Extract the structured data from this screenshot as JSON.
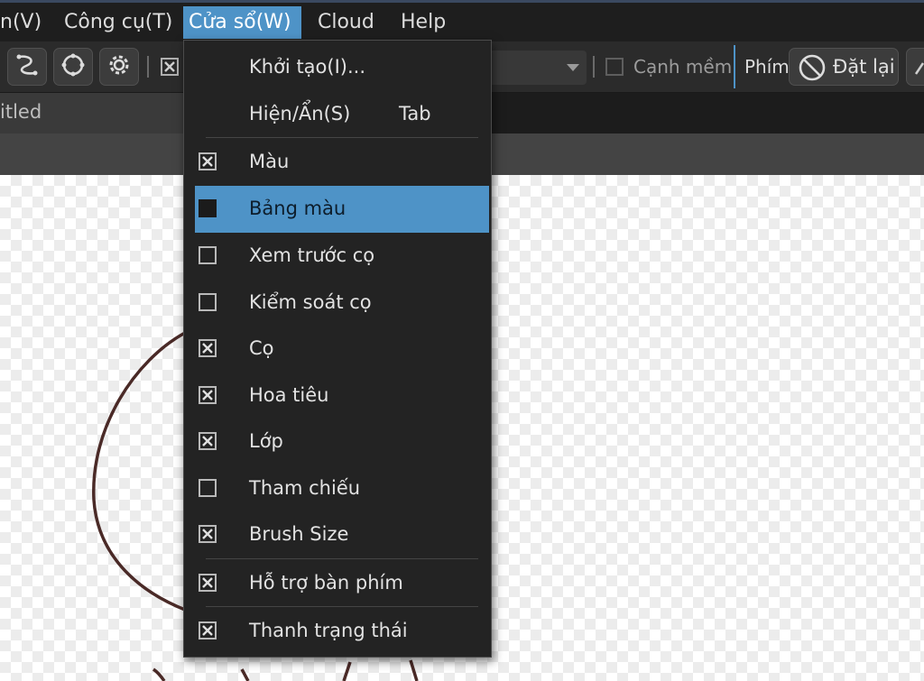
{
  "menubar": {
    "items": [
      "n(V)",
      "Công cụ(T)",
      "Cửa sổ(W)",
      "Cloud",
      "Help"
    ]
  },
  "toolbar": {
    "soft_edge_label": "Cạnh mềm",
    "key_label": "Phím",
    "reset_label": "Đặt lại"
  },
  "tab": {
    "title": "itled"
  },
  "window_menu": {
    "items": [
      {
        "label": "Khởi tạo(I)...",
        "check": "none"
      },
      {
        "label": "Hiện/Ẩn(S)",
        "shortcut": "Tab",
        "check": "none"
      },
      {
        "label": "Màu",
        "check": "checked"
      },
      {
        "label": "Bảng màu",
        "check": "filled",
        "highlighted": true
      },
      {
        "label": "Xem trước cọ",
        "check": "unchecked"
      },
      {
        "label": "Kiểm soát cọ",
        "check": "unchecked"
      },
      {
        "label": "Cọ",
        "check": "checked"
      },
      {
        "label": "Hoa tiêu",
        "check": "checked"
      },
      {
        "label": "Lớp",
        "check": "checked"
      },
      {
        "label": "Tham chiếu",
        "check": "unchecked"
      },
      {
        "label": "Brush Size",
        "check": "checked"
      },
      {
        "label": "Hỗ trợ bàn phím",
        "check": "checked"
      },
      {
        "label": "Thanh trạng thái",
        "check": "checked"
      }
    ]
  },
  "colors": {
    "accent": "#4e93c7",
    "stroke": "#4a2a27"
  }
}
